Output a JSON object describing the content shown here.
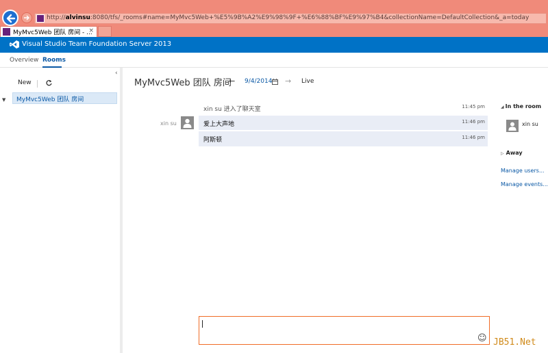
{
  "browser": {
    "url_prefix": "http://",
    "url_host": "alvinsu",
    "url_rest": ":8080/tfs/_rooms#name=MyMvc5Web+%E5%9B%A2%E9%98%9F+%E6%88%BF%E9%97%B4&collectionName=DefaultCollection&_a=today",
    "tab_title": "MyMvc5Web 团队 房间 - ...",
    "tab_close": "×"
  },
  "header": {
    "product_title": "Visual Studio Team Foundation Server 2013",
    "brand_color": "#0072c6"
  },
  "subnav": {
    "overview": "Overview",
    "rooms": "Rooms"
  },
  "sidebar": {
    "collapse": "‹",
    "new_label": "New",
    "rooms": [
      {
        "label": "MyMvc5Web 团队 房间",
        "selected": true
      }
    ]
  },
  "room": {
    "title": "MyMvc5Web 团队 房间",
    "prev": "←",
    "date": "9/4/2014",
    "next": "→",
    "live": "Live"
  },
  "messages": {
    "system_line": {
      "text": "xin su 进入了聊天室",
      "time": "11:45 pm"
    },
    "author": "xin su",
    "items": [
      {
        "text": "爱上大声地",
        "time": "11:46 pm"
      },
      {
        "text": "阿斯顿",
        "time": "11:46 pm"
      }
    ]
  },
  "compose": {
    "smiley": "☺"
  },
  "right_panel": {
    "in_room_header": "In the room",
    "in_room_user": "xin su",
    "away_header": "Away",
    "manage_users": "Manage users...",
    "manage_events": "Manage events..."
  },
  "watermark": "JB51.Net",
  "colors": {
    "accent_link": "#0a58a5",
    "compose_border": "#f06b25",
    "message_bg": "#e9edf6"
  }
}
